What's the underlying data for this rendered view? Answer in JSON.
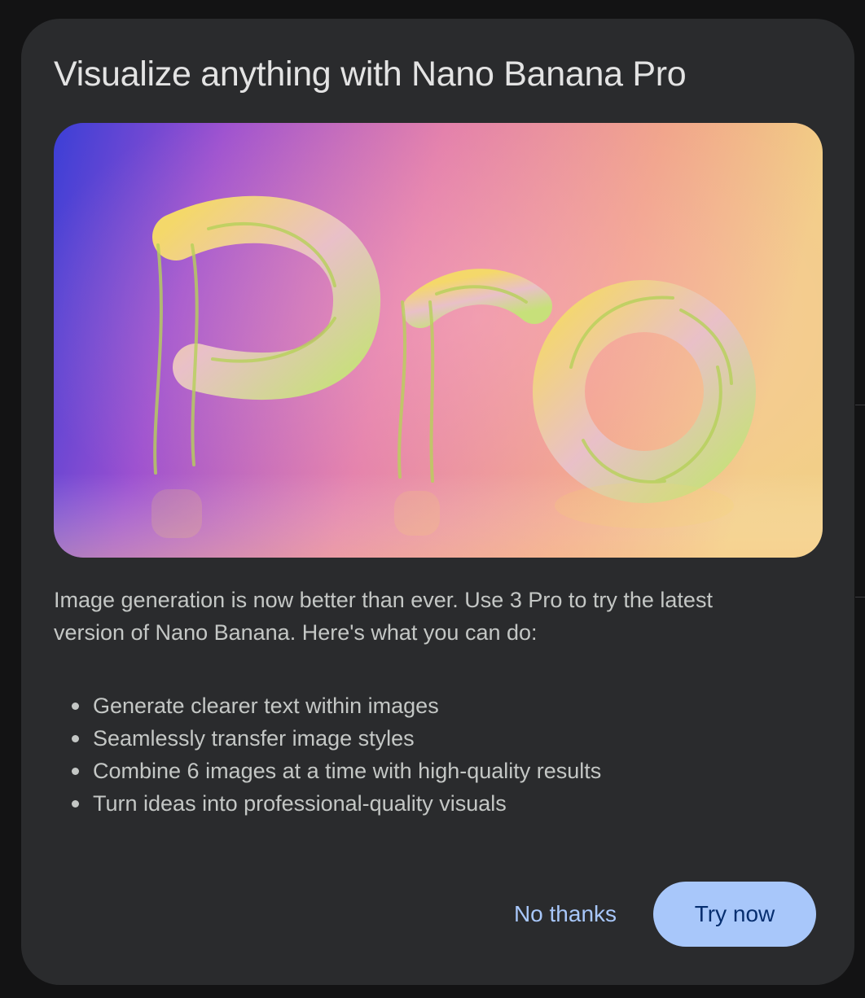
{
  "dialog": {
    "title": "Visualize anything with Nano Banana Pro",
    "hero_image": {
      "lettering": "Pro",
      "depiction": "word made of bananas on a blue-pink-yellow gradient"
    },
    "description": "Image generation is now better than ever. Use 3 Pro to try the latest version of Nano Banana. Here's what you can do:",
    "features": [
      "Generate clearer text within images",
      "Seamlessly transfer image styles",
      "Combine 6 images at a time with high-quality results",
      "Turn ideas into professional-quality visuals"
    ],
    "actions": {
      "dismiss_label": "No thanks",
      "confirm_label": "Try now"
    }
  },
  "colors": {
    "dialog_background": "#2a2b2d",
    "title_text": "#e3e3e3",
    "body_text": "#c4c7c5",
    "accent": "#a8c7fa",
    "accent_on": "#062e6f"
  }
}
